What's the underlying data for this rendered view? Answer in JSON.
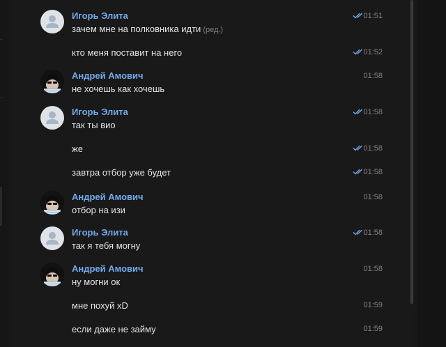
{
  "messages": [
    {
      "author": "Игорь Элита",
      "avatar": "default",
      "text": "зачем мне на полковника идти",
      "edited": "(ред.)",
      "time": "01:51",
      "read": true
    },
    {
      "author": "",
      "avatar": "",
      "text": "кто меня поставит на него",
      "edited": "",
      "time": "01:52",
      "read": true
    },
    {
      "author": "Андрей Амович",
      "avatar": "photo",
      "text": "не хочешь как хочешь",
      "edited": "",
      "time": "01:58",
      "read": false
    },
    {
      "author": "Игорь Элита",
      "avatar": "default",
      "text": "так ты вио",
      "edited": "",
      "time": "01:58",
      "read": true
    },
    {
      "author": "",
      "avatar": "",
      "text": "же",
      "edited": "",
      "time": "01:58",
      "read": true
    },
    {
      "author": "",
      "avatar": "",
      "text": "завтра отбор уже будет",
      "edited": "",
      "time": "01:58",
      "read": true
    },
    {
      "author": "Андрей Амович",
      "avatar": "photo",
      "text": "отбор на изи",
      "edited": "",
      "time": "01:58",
      "read": false
    },
    {
      "author": "Игорь Элита",
      "avatar": "default",
      "text": "так я тебя могну",
      "edited": "",
      "time": "01:58",
      "read": true
    },
    {
      "author": "Андрей Амович",
      "avatar": "photo",
      "text": "ну могни ок",
      "edited": "",
      "time": "01:58",
      "read": false
    },
    {
      "author": "",
      "avatar": "",
      "text": "мне похуй xD",
      "edited": "",
      "time": "01:59",
      "read": false
    },
    {
      "author": "",
      "avatar": "",
      "text": "если даже не займу",
      "edited": "",
      "time": "01:59",
      "read": false
    }
  ],
  "colors": {
    "background": "#191919",
    "author_name": "#71aaeb",
    "message_text": "#e1e3e6",
    "meta_text": "#828282",
    "read_check": "#71aaeb"
  },
  "icons": {
    "default_avatar": "person-silhouette-icon",
    "read_receipt": "double-check-icon"
  }
}
